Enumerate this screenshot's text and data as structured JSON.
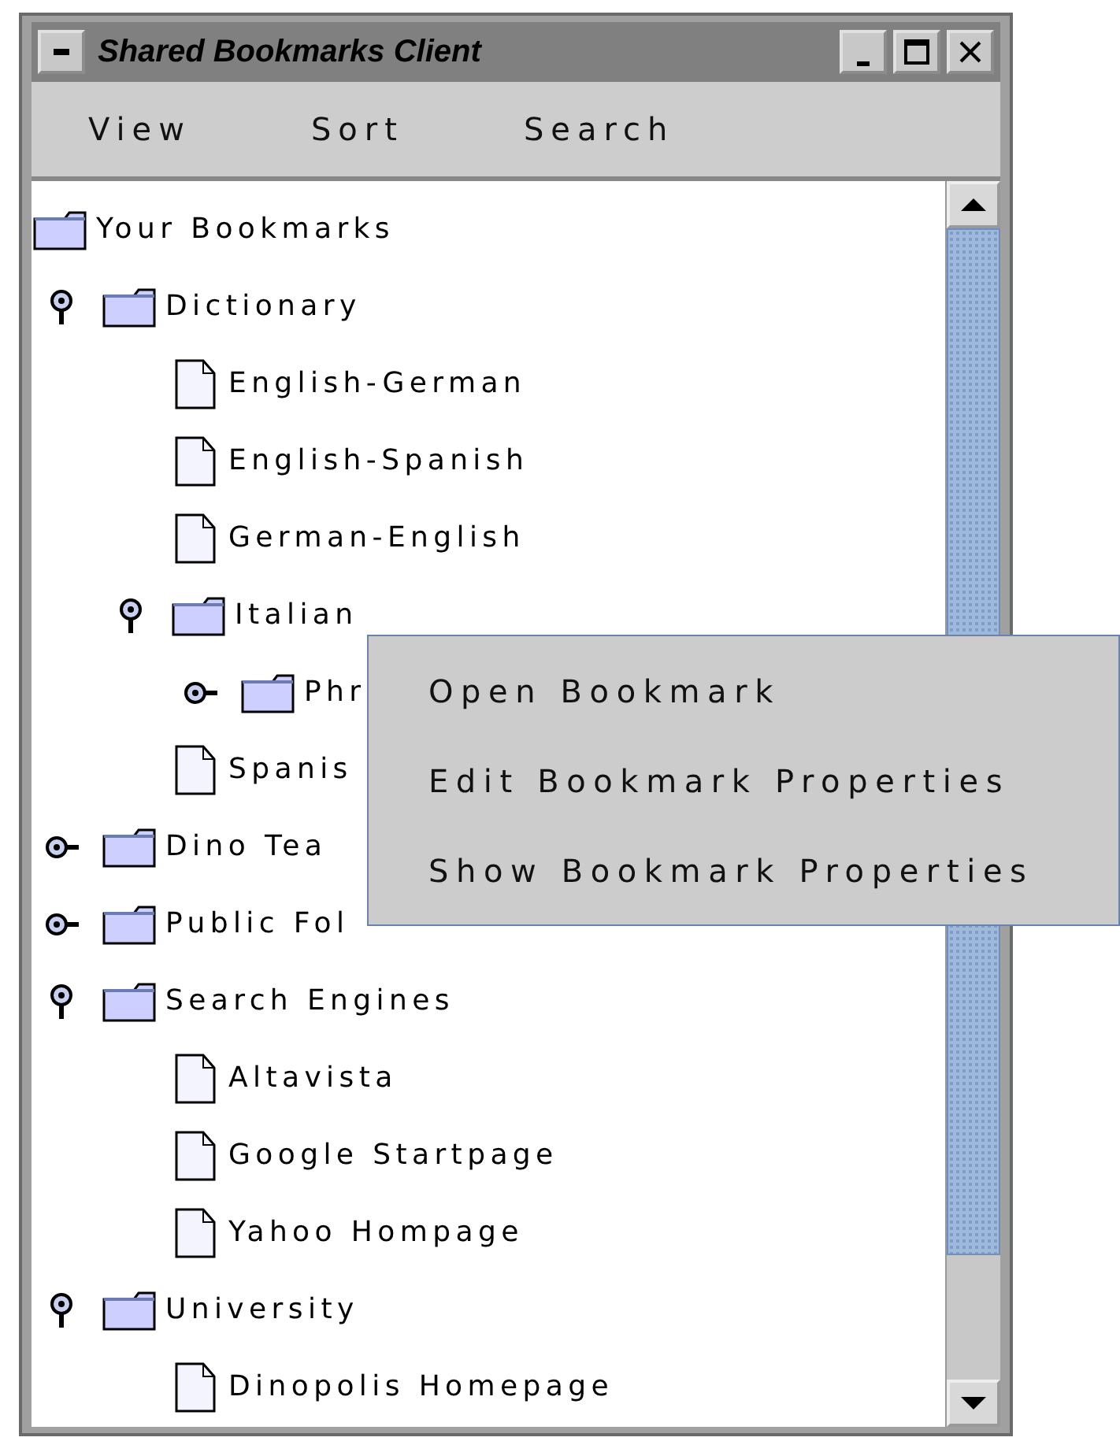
{
  "window": {
    "title": "Shared Bookmarks Client"
  },
  "menu": [
    "View",
    "Sort",
    "Search"
  ],
  "tree": {
    "label": "Your Bookmarks",
    "kind": "folder",
    "children": [
      {
        "label": "Dictionary",
        "kind": "folder",
        "expanded": true,
        "children": [
          {
            "label": "English-German",
            "kind": "bookmark"
          },
          {
            "label": "English-Spanish",
            "kind": "bookmark"
          },
          {
            "label": "German-English",
            "kind": "bookmark"
          },
          {
            "label": "Italian",
            "kind": "folder",
            "expanded": true,
            "children": [
              {
                "label": "Phr",
                "kind": "folder",
                "expanded": false
              }
            ]
          },
          {
            "label": "Spanis",
            "kind": "bookmark"
          }
        ]
      },
      {
        "label": "Dino Tea",
        "kind": "folder",
        "expanded": false
      },
      {
        "label": "Public Fol",
        "kind": "folder",
        "expanded": false
      },
      {
        "label": "Search Engines",
        "kind": "folder",
        "expanded": true,
        "children": [
          {
            "label": "Altavista",
            "kind": "bookmark"
          },
          {
            "label": "Google Startpage",
            "kind": "bookmark"
          },
          {
            "label": "Yahoo Hompage",
            "kind": "bookmark"
          }
        ]
      },
      {
        "label": "University",
        "kind": "folder",
        "expanded": true,
        "children": [
          {
            "label": "Dinopolis Homepage",
            "kind": "bookmark"
          }
        ]
      }
    ]
  },
  "context_menu": [
    "Open Bookmark",
    "Edit Bookmark Properties",
    "Show Bookmark Properties"
  ]
}
